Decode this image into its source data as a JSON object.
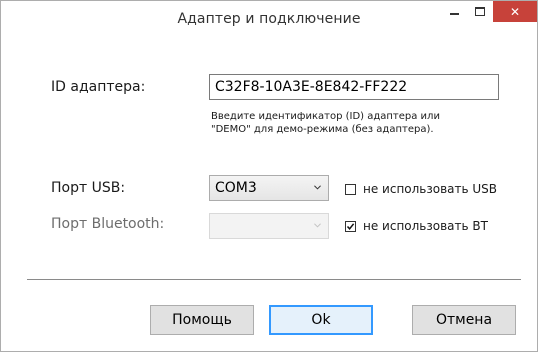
{
  "window": {
    "title": "Адаптер и подключение",
    "close_symbol": "✕"
  },
  "adapter": {
    "label": "ID адаптера:",
    "value": "C32F8-10A3E-8E842-FF222",
    "hint_line1": "Введите идентификатор (ID) адаптера или",
    "hint_line2": "\"DEMO\" для демо-режима (без адаптера)."
  },
  "usb": {
    "label": "Порт USB:",
    "selected": "COM3",
    "checkbox_label": "не использовать USB",
    "checked": false
  },
  "bluetooth": {
    "label": "Порт Bluetooth:",
    "selected": "",
    "checkbox_label": "не использовать BT",
    "checked": true
  },
  "buttons": {
    "help": "Помощь",
    "ok": "Ok",
    "cancel": "Отмена"
  },
  "colors": {
    "close_button": "#c7423a",
    "default_button_border": "#3399ff"
  }
}
